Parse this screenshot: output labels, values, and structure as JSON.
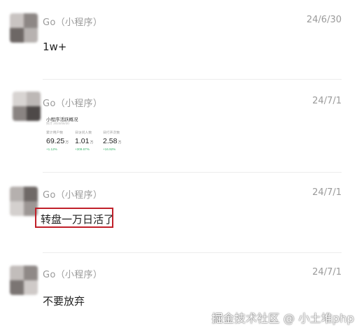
{
  "messages": [
    {
      "sender": "Go（小程序）",
      "time": "24/6/30",
      "text": "1w+"
    },
    {
      "sender": "Go（小程序）",
      "time": "24/7/1",
      "card": {
        "title": "小程序活跃概况",
        "subtitle": "统计 2024/06/30",
        "stats": [
          {
            "label": "累计用户数",
            "value": "69.25",
            "unit": "万",
            "change": "+1.12%"
          },
          {
            "label": "日访问人数",
            "value": "1.01",
            "unit": "万",
            "change": "+309.67%"
          },
          {
            "label": "日打开次数",
            "value": "2.58",
            "unit": "万",
            "change": "+16.92%"
          }
        ]
      }
    },
    {
      "sender": "Go（小程序）",
      "time": "24/7/1",
      "text": "转盘一万日活了"
    },
    {
      "sender": "Go（小程序）",
      "time": "24/7/1",
      "text": "不要放弃"
    }
  ],
  "watermark": "掘金技术社区 @ 小土堆php",
  "colors": {
    "meta_text": "#9a9a9a",
    "body_text": "#1f1f1f",
    "highlight_border": "#c0202a",
    "positive_change": "#37b36a"
  },
  "icons": [
    "avatar"
  ]
}
